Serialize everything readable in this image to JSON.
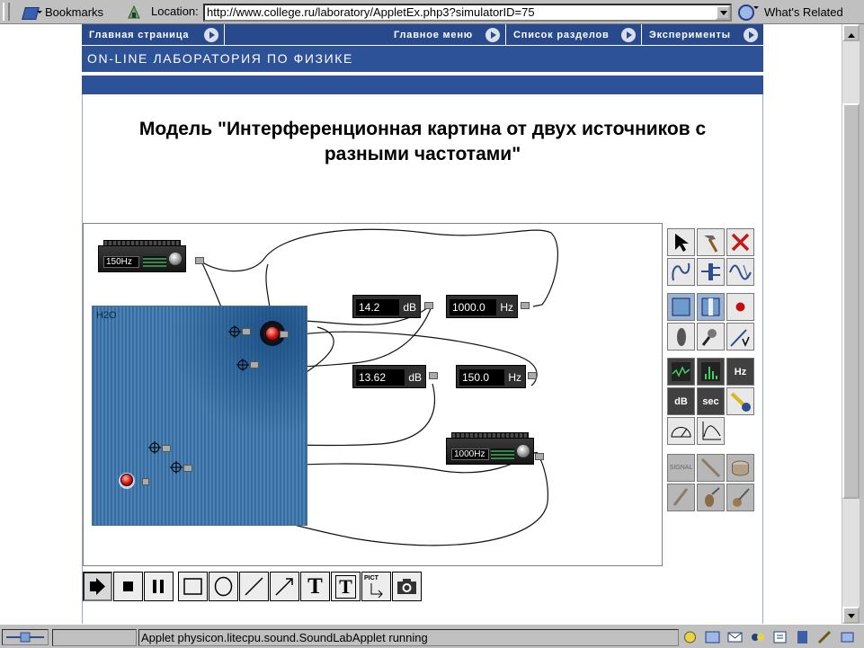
{
  "browser": {
    "bookmarks_label": "Bookmarks",
    "location_label": "Location:",
    "url": "http://www.college.ru/laboratory/AppletEx.php3?simulatorID=75",
    "related_label": "What's Related",
    "status_text": "Applet physicon.litecpu.sound.SoundLabApplet running"
  },
  "site": {
    "nav": [
      {
        "label": "Главная страница"
      },
      {
        "label": "Главное меню"
      },
      {
        "label": "Список разделов"
      },
      {
        "label": "Эксперименты"
      }
    ],
    "banner": "ON-LINE ЛАБОРАТОРИЯ ПО ФИЗИКЕ"
  },
  "page": {
    "title_line1": "Модель \"Интерференционная картина от двух источников с",
    "title_line2": "разными частотами\""
  },
  "applet": {
    "generator_top": {
      "label": "150Hz"
    },
    "generator_bottom": {
      "label": "1000Hz"
    },
    "tank_label": "H2O",
    "meters": [
      {
        "value": "14.2",
        "unit": "dB"
      },
      {
        "value": "1000.0",
        "unit": "Hz"
      },
      {
        "value": "13.62",
        "unit": "dB"
      },
      {
        "value": "150.0",
        "unit": "Hz"
      }
    ],
    "palette_labels": {
      "hz": "Hz",
      "db": "dB",
      "sec": "sec",
      "signal": "SIGNAL"
    },
    "drawbar": {
      "text_tool": "T",
      "text_box_tool": "T",
      "pict_label": "PICT"
    }
  }
}
